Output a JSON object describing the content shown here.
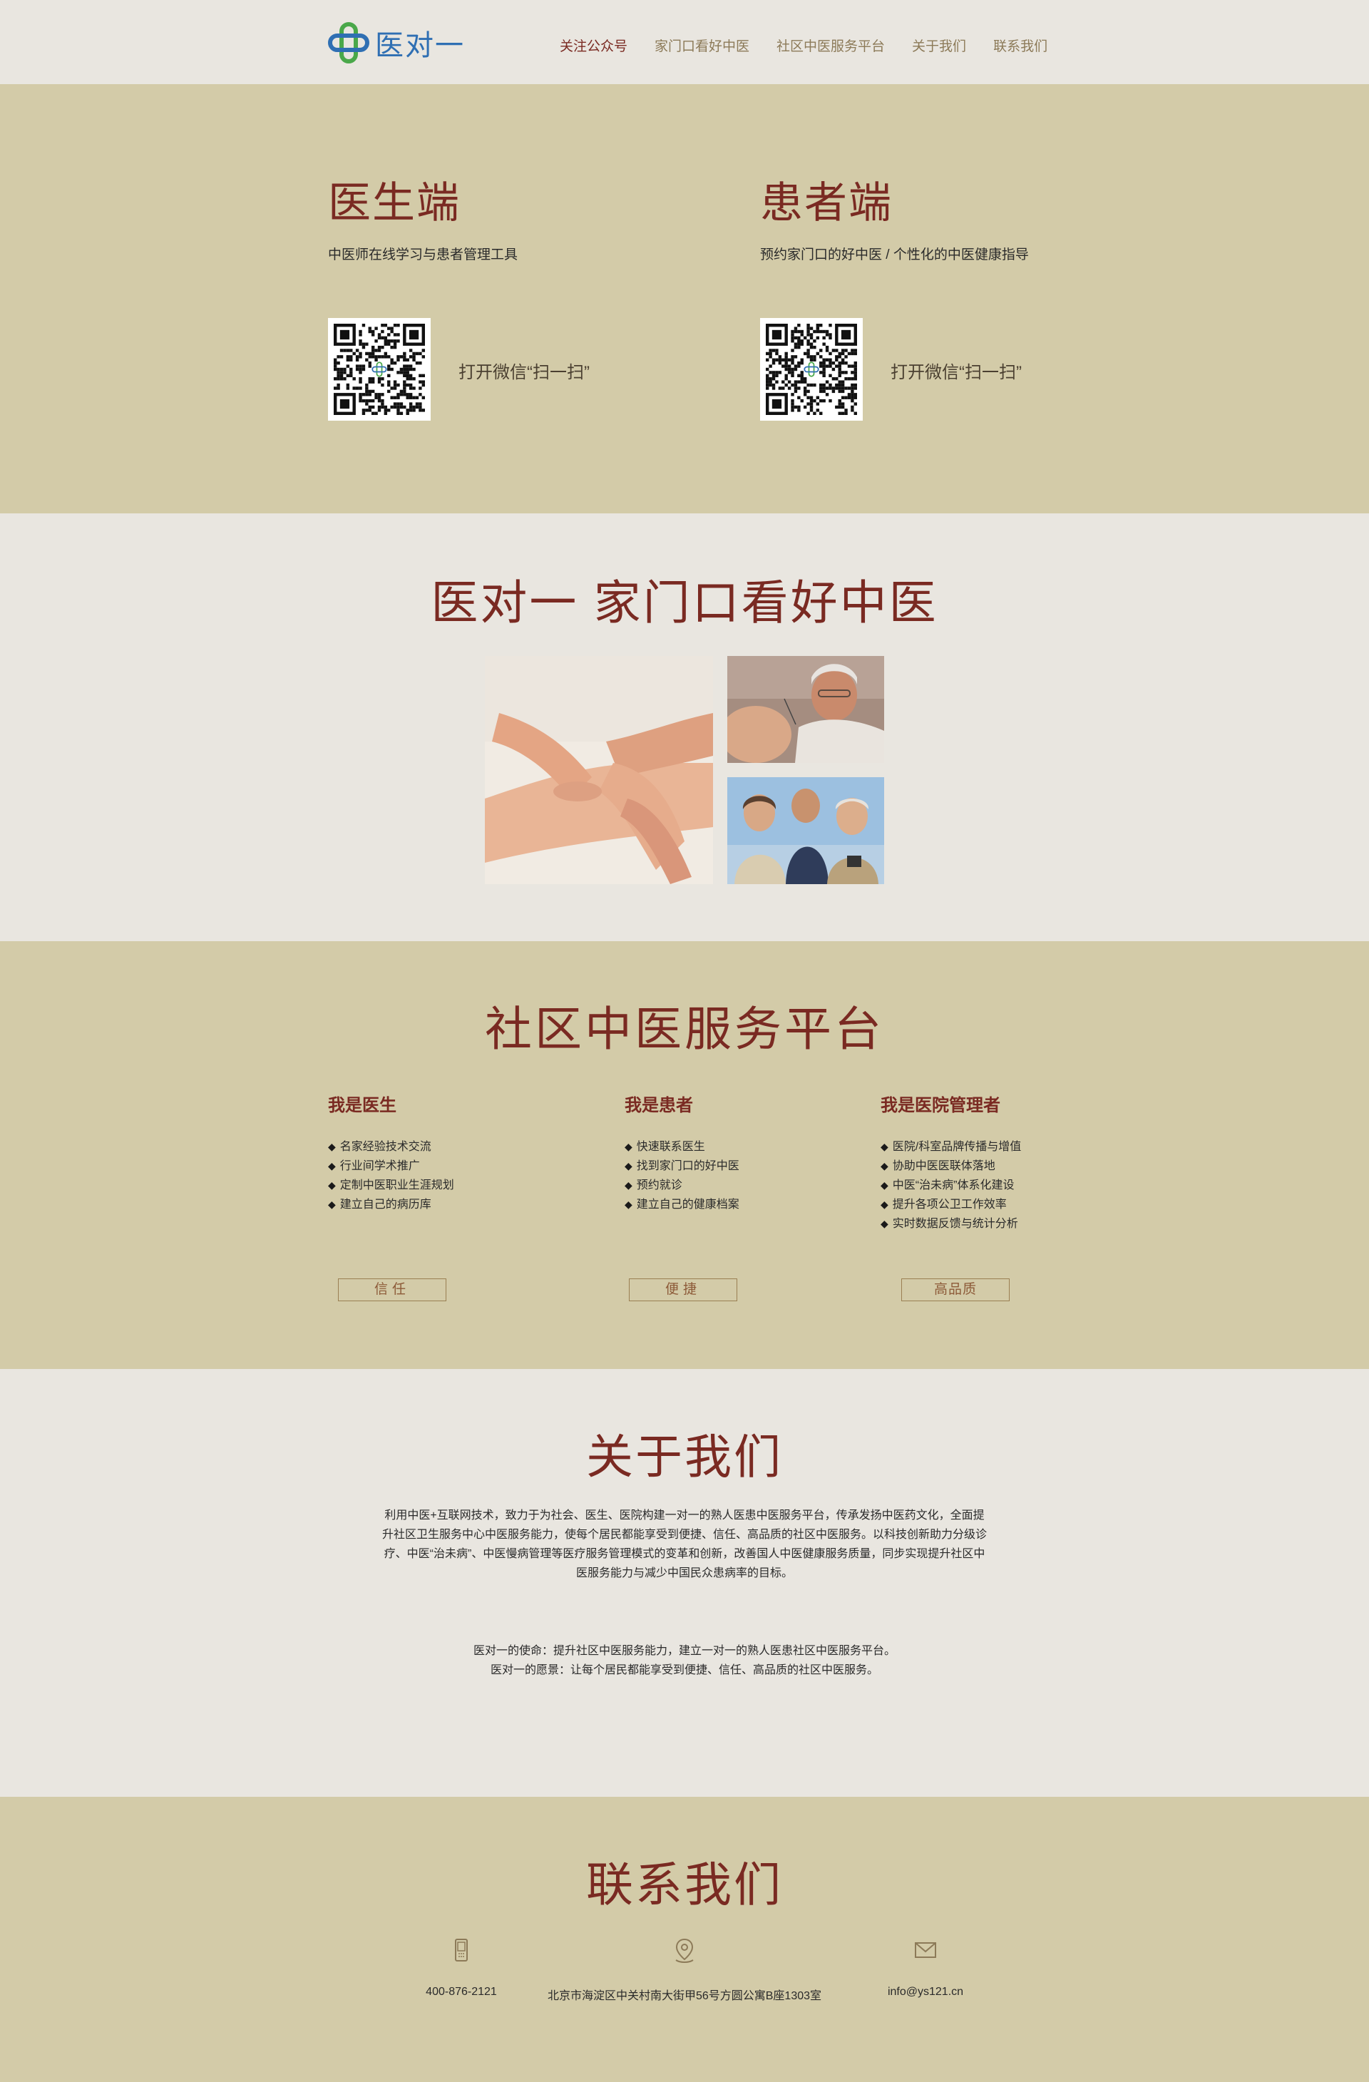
{
  "header": {
    "logo_text": "医对一",
    "nav": [
      {
        "label": "关注公众号",
        "active": true
      },
      {
        "label": "家门口看好中医",
        "active": false
      },
      {
        "label": "社区中医服务平台",
        "active": false
      },
      {
        "label": "关于我们",
        "active": false
      },
      {
        "label": "联系我们",
        "active": false
      }
    ]
  },
  "download": {
    "doctor": {
      "title": "医生端",
      "subtitle": "中医师在线学习与患者管理工具",
      "scan": "打开微信“扫一扫”"
    },
    "patient": {
      "title": "患者端",
      "subtitle": "预约家门口的好中医 / 个性化的中医健康指导",
      "scan": "打开微信“扫一扫”"
    }
  },
  "slogan": {
    "title": "医对一 家门口看好中医"
  },
  "platform": {
    "title": "社区中医服务平台",
    "columns": [
      {
        "heading": "我是医生",
        "items": [
          "名家经验技术交流",
          "行业间学术推广",
          "定制中医职业生涯规划",
          "建立自己的病历库"
        ],
        "tag": "信任"
      },
      {
        "heading": "我是患者",
        "items": [
          "快速联系医生",
          "找到家门口的好中医",
          "预约就诊",
          "建立自己的健康档案"
        ],
        "tag": "便捷"
      },
      {
        "heading": "我是医院管理者",
        "items": [
          "医院/科室品牌传播与增值",
          "协助中医医联体落地",
          "中医“治未病”体系化建设",
          "提升各项公卫工作效率",
          "实时数据反馈与统计分析"
        ],
        "tag": "高品质"
      }
    ]
  },
  "about": {
    "title": "关于我们",
    "paragraph": "利用中医+互联网技术，致力于为社会、医生、医院构建一对一的熟人医患中医服务平台，传承发扬中医药文化，全面提升社区卫生服务中心中医服务能力，使每个居民都能享受到便捷、信任、高品质的社区中医服务。以科技创新助力分级诊疗、中医“治未病”、中医慢病管理等医疗服务管理模式的变革和创新，改善国人中医健康服务质量，同步实现提升社区中医服务能力与减少中国民众患病率的目标。",
    "mission": "医对一的使命：提升社区中医服务能力，建立一对一的熟人医患社区中医服务平台。",
    "vision": "医对一的愿景：让每个居民都能享受到便捷、信任、高品质的社区中医服务。"
  },
  "contact": {
    "title": "联系我们",
    "phone": "400-876-2121",
    "address": "北京市海淀区中关村南大街甲56号方圆公寓B座1303室",
    "email": "info@ys121.cn"
  },
  "colors": {
    "accent": "#7a2a22",
    "khaki": "#d3cba8",
    "light": "#e9e6e0",
    "logo_blue": "#2f6fb3",
    "logo_green": "#4aa84a"
  }
}
